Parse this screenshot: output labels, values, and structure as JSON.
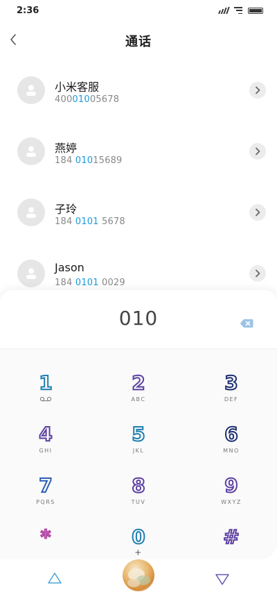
{
  "status_bar": {
    "time": "2:36"
  },
  "header": {
    "title": "通话"
  },
  "contacts": [
    {
      "name": "小米客服",
      "number_parts": [
        "400",
        "010",
        "05678"
      ]
    },
    {
      "name": "燕婷",
      "number_parts": [
        "184 ",
        "010",
        "15689"
      ]
    },
    {
      "name": "子玲",
      "number_parts": [
        "184 ",
        "0101",
        " 5678"
      ]
    },
    {
      "name": "Jason",
      "number_parts": [
        "184 ",
        "0101",
        " 0029"
      ]
    }
  ],
  "dialpad": {
    "dialed": "010",
    "keys": [
      {
        "digit": "1",
        "letters": ""
      },
      {
        "digit": "2",
        "letters": "ABC"
      },
      {
        "digit": "3",
        "letters": "DEF"
      },
      {
        "digit": "4",
        "letters": "GHI"
      },
      {
        "digit": "5",
        "letters": "JKL"
      },
      {
        "digit": "6",
        "letters": "MNO"
      },
      {
        "digit": "7",
        "letters": "PQRS"
      },
      {
        "digit": "8",
        "letters": "TUV"
      },
      {
        "digit": "9",
        "letters": "WXYZ"
      },
      {
        "digit": "*",
        "letters": ""
      },
      {
        "digit": "0",
        "letters": "+"
      },
      {
        "digit": "#",
        "letters": ""
      }
    ]
  },
  "icons": {
    "back": "chevron-left-icon",
    "avatar": "person-icon",
    "detail": "chevron-right-icon",
    "backspace": "backspace-icon",
    "voicemail": "voicemail-icon",
    "collapse": "triangle-up-icon",
    "expand": "triangle-down-icon"
  },
  "colors": {
    "highlight": "#1a9bdc",
    "backspace": "#9cc3e6"
  }
}
